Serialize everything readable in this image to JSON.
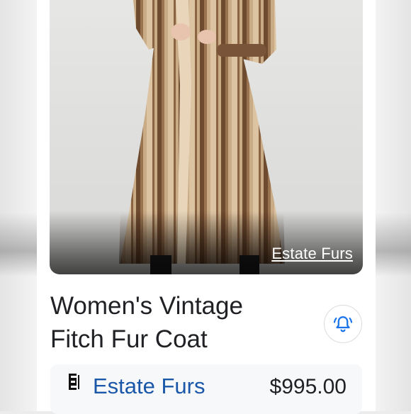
{
  "product": {
    "title": "Women's Vintage Fitch Fur Coat",
    "image_source": "Estate Furs",
    "image_alt": "Woman wearing long vintage fitch fur coat"
  },
  "alert": {
    "icon": "bell-alert-icon",
    "accent_color": "#1a73e8"
  },
  "offer": {
    "merchant_logo": "merchant-logo-icon",
    "merchant_name": "Estate Furs",
    "price": "$995.00",
    "merchant_color": "#1a57a8"
  }
}
